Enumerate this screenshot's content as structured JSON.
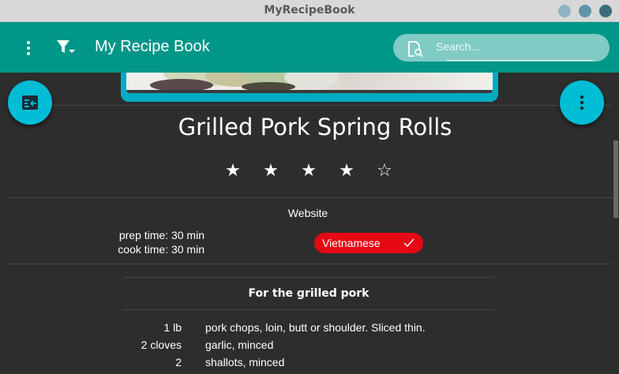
{
  "window": {
    "title": "MyRecipeBook",
    "buttons": [
      {
        "name": "minimize",
        "color": "#8fb4c2"
      },
      {
        "name": "maximize",
        "color": "#5d95a7"
      },
      {
        "name": "close",
        "color": "#3d6c7d"
      }
    ]
  },
  "appbar": {
    "title": "My Recipe Book",
    "background": "#009688",
    "menu_icon": "more-vert-icon",
    "filter_icon": "filter-list-icon",
    "search": {
      "placeholder": "Search...",
      "value": "",
      "icon": "search-icon"
    }
  },
  "fabs": {
    "left_icon": "edit-note-icon",
    "right_icon": "more-vert-icon",
    "color": "#00bcd4"
  },
  "recipe": {
    "title": "Grilled Pork Spring Rolls",
    "rating": 4,
    "max_rating": 5,
    "source": "Website",
    "prep_time": "prep time: 30 min",
    "cook_time": "cook time: 30 min",
    "cuisine": {
      "label": "Vietnamese",
      "selected": true,
      "color": "#e50914"
    },
    "sections": [
      {
        "title": "For the grilled pork",
        "ingredients": [
          {
            "qty": "1 lb",
            "desc": "pork chops, loin, butt or shoulder. Sliced thin."
          },
          {
            "qty": "2 cloves",
            "desc": "garlic, minced"
          },
          {
            "qty": "2",
            "desc": "shallots, minced"
          }
        ]
      }
    ]
  }
}
